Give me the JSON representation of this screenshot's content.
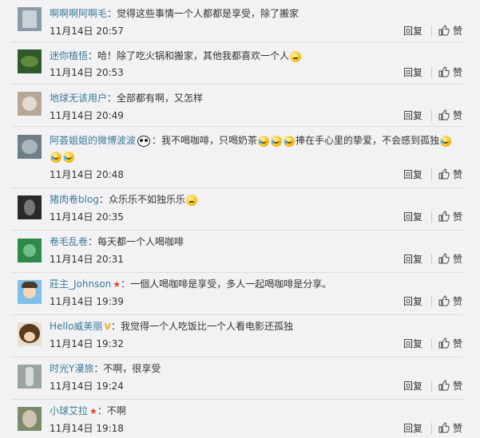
{
  "actions": {
    "reply_label": "回复",
    "like_label": "赞",
    "like_icon": "thumbs-up-icon"
  },
  "comments": [
    {
      "username": "啊啊啊阿啊毛",
      "colon": "：",
      "text": "觉得这些事情一个人都都是享受，除了搬家",
      "time": "11月14日 20:57",
      "avatar_color": "#8a9aa6"
    },
    {
      "username": "迷你植悟",
      "colon": "：",
      "text": "哈！除了吃火锅和搬家，其他我都喜欢一个人",
      "emoji": "thinking-emoji",
      "time": "11月14日 20:53",
      "avatar_color": "#2f5a2a"
    },
    {
      "username": "地球无该用户",
      "colon": "：",
      "text": "全部都有啊，又怎样",
      "time": "11月14日 20:49",
      "avatar_color": "#b7a795"
    },
    {
      "username": "阿荟姐姐的微博波波",
      "colon": "：",
      "text_a": "我不喝咖啡，只喝奶茶",
      "text_b": "捧在手心里的挚爱，不会感到孤独",
      "emoji": "tears-of-joy-emoji",
      "time": "11月14日 20:48",
      "avatar_color": "#6e7d86"
    },
    {
      "username": "猪肉卷blog",
      "colon": "：",
      "text": "众乐乐不如独乐乐",
      "emoji": "thinking-emoji",
      "time": "11月14日 20:35",
      "avatar_color": "#2a2a2a"
    },
    {
      "username": "卷毛乱卷",
      "colon": "：",
      "text": "每天都一个人喝咖啡",
      "time": "11月14日 20:31",
      "avatar_color": "#2f8a4a"
    },
    {
      "username": "莊主_Johnson",
      "colon": "：",
      "text": "一個人喝咖啡是享受，多人一起喝咖啡是分享。",
      "badge": "red-star-badge",
      "time": "11月14日 19:39",
      "avatar_color": "#7fc0e8"
    },
    {
      "username": "Hello威美丽",
      "colon": "：",
      "text": "我觉得一个人吃饭比一个人看电影还孤独",
      "badge": "gold-v-badge",
      "time": "11月14日 19:32",
      "avatar_color": "#5a3a1e"
    },
    {
      "username": "时光Y漫旅",
      "colon": "：",
      "text": "不啊，很享受",
      "time": "11月14日 19:24",
      "avatar_color": "#9aa5a0"
    },
    {
      "username": "小球艾拉",
      "colon": "：",
      "text": "不啊",
      "badge": "red-star-badge",
      "time": "11月14日 19:18",
      "avatar_color": "#7a8a6a"
    }
  ]
}
